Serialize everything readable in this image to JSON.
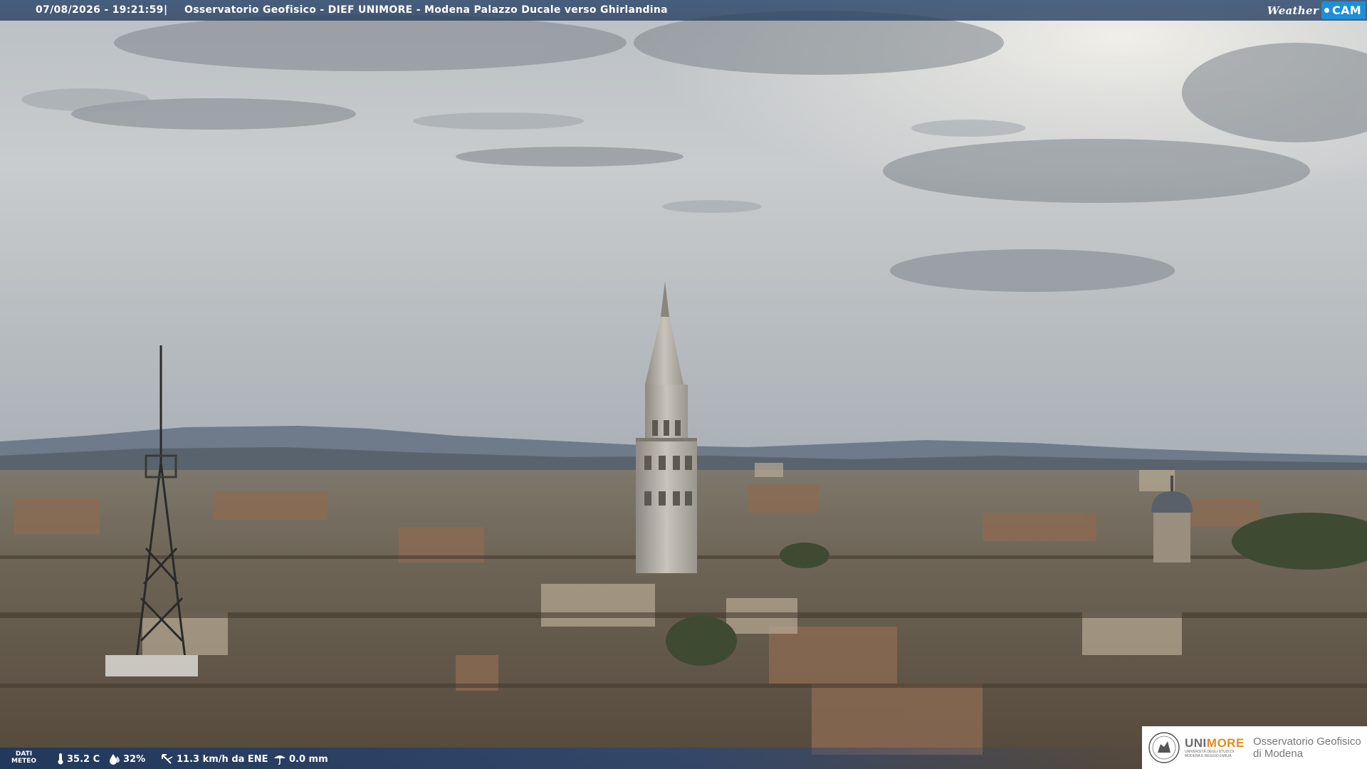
{
  "caption": {
    "timestamp": "07/08/2026 - 19:21:59",
    "separator": "|",
    "location": "Osservatorio Geofisico - DIEF UNIMORE - Modena Palazzo Ducale verso Ghirlandina"
  },
  "brand": {
    "weather": "Weather",
    "cam": "CAM"
  },
  "weather": {
    "label_line1": "DATI",
    "label_line2": "METEO",
    "temperature": "35.2 C",
    "humidity": "32%",
    "wind": "11.3 km/h da ENE",
    "rain": "0.0 mm"
  },
  "logo": {
    "uni": "UNI",
    "more": "MORE",
    "subtitle": "UNIVERSITÀ DEGLI STUDI DI MODENA E REGGIO EMILIA",
    "observatory_line1": "Osservatorio Geofisico",
    "observatory_line2": "di Modena"
  },
  "colors": {
    "bar": "#2e4a72",
    "cam_accent": "#1e8fd6",
    "unimore_orange": "#e88a1a"
  }
}
